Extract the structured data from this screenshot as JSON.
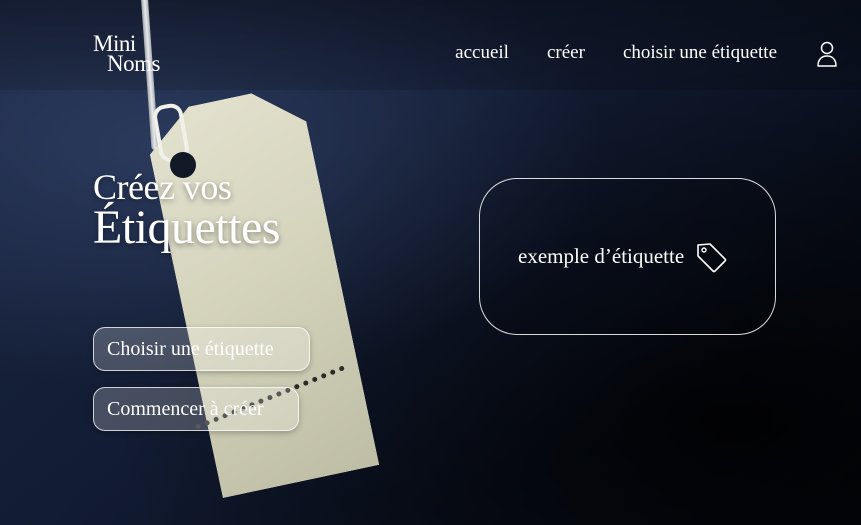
{
  "brand": {
    "logo_line1": "Mini",
    "logo_line2": "Noms"
  },
  "nav": {
    "items": [
      {
        "label": "accueil"
      },
      {
        "label": "créer"
      },
      {
        "label": "choisir une étiquette"
      }
    ],
    "user_icon": "user-icon"
  },
  "hero": {
    "title_small": "Créez vos",
    "title_big": "Étiquettes"
  },
  "buttons": {
    "choose_label": "Choisir une étiquette",
    "create_label": "Commencer à créer"
  },
  "example": {
    "label": "exemple d’étiquette",
    "icon": "tag-icon"
  },
  "colors": {
    "background": "#121c33",
    "text": "#ffffff",
    "button_fill": "rgba(255,255,255,0.22)"
  }
}
